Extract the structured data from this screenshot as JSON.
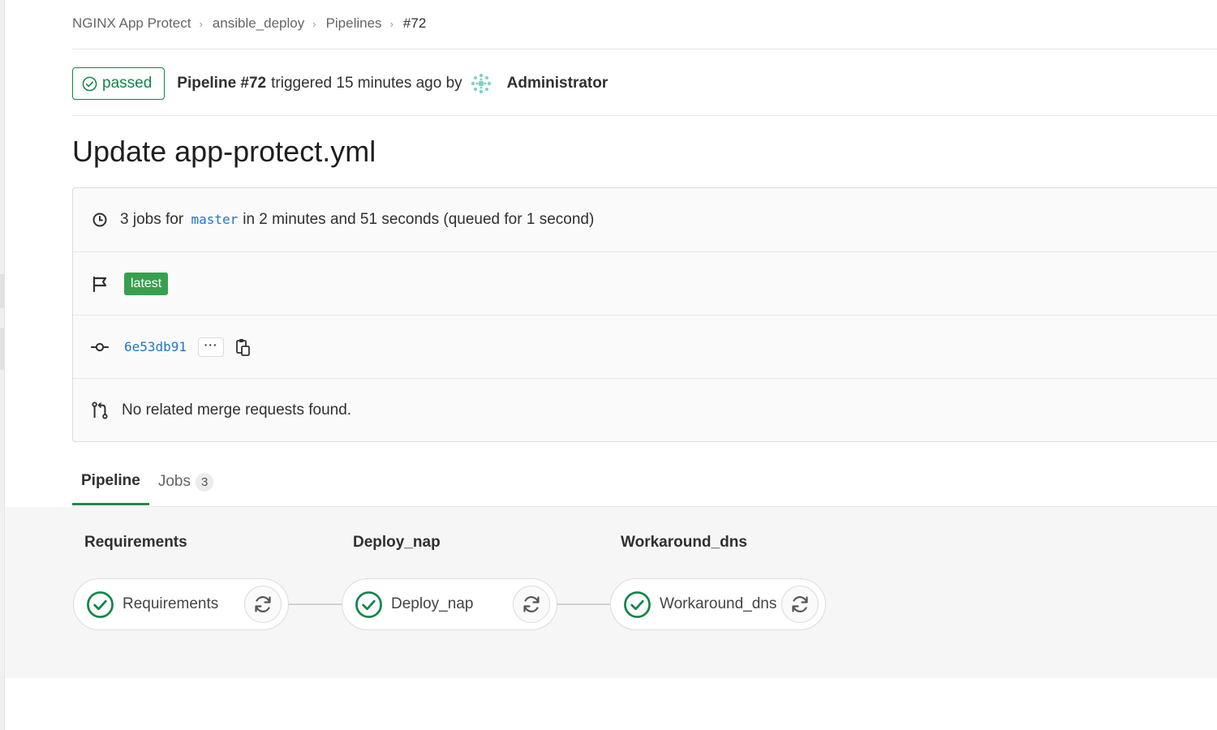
{
  "breadcrumb": {
    "items": [
      "NGINX App Protect",
      "ansible_deploy",
      "Pipelines"
    ],
    "current": "#72"
  },
  "header": {
    "status": "passed",
    "pipeline_label": "Pipeline #72",
    "trigger_text": "triggered 15 minutes ago by",
    "user": "Administrator"
  },
  "commit_title": "Update app-protect.yml",
  "info": {
    "jobs_prefix": "3 jobs for",
    "branch": "master",
    "jobs_suffix": "in 2 minutes and 51 seconds (queued for 1 second)",
    "tag": "latest",
    "sha": "6e53db91",
    "ellipsis": "···",
    "merge_requests": "No related merge requests found."
  },
  "tabs": [
    {
      "label": "Pipeline",
      "active": true
    },
    {
      "label": "Jobs",
      "count": "3",
      "active": false
    }
  ],
  "stages": [
    {
      "title": "Requirements",
      "job": "Requirements",
      "status": "success"
    },
    {
      "title": "Deploy_nap",
      "job": "Deploy_nap",
      "status": "success"
    },
    {
      "title": "Workaround_dns",
      "job": "Workaround_dns",
      "status": "success"
    }
  ],
  "colors": {
    "success": "#108548",
    "link": "#1f75cb",
    "latest_badge": "#37a04f"
  }
}
